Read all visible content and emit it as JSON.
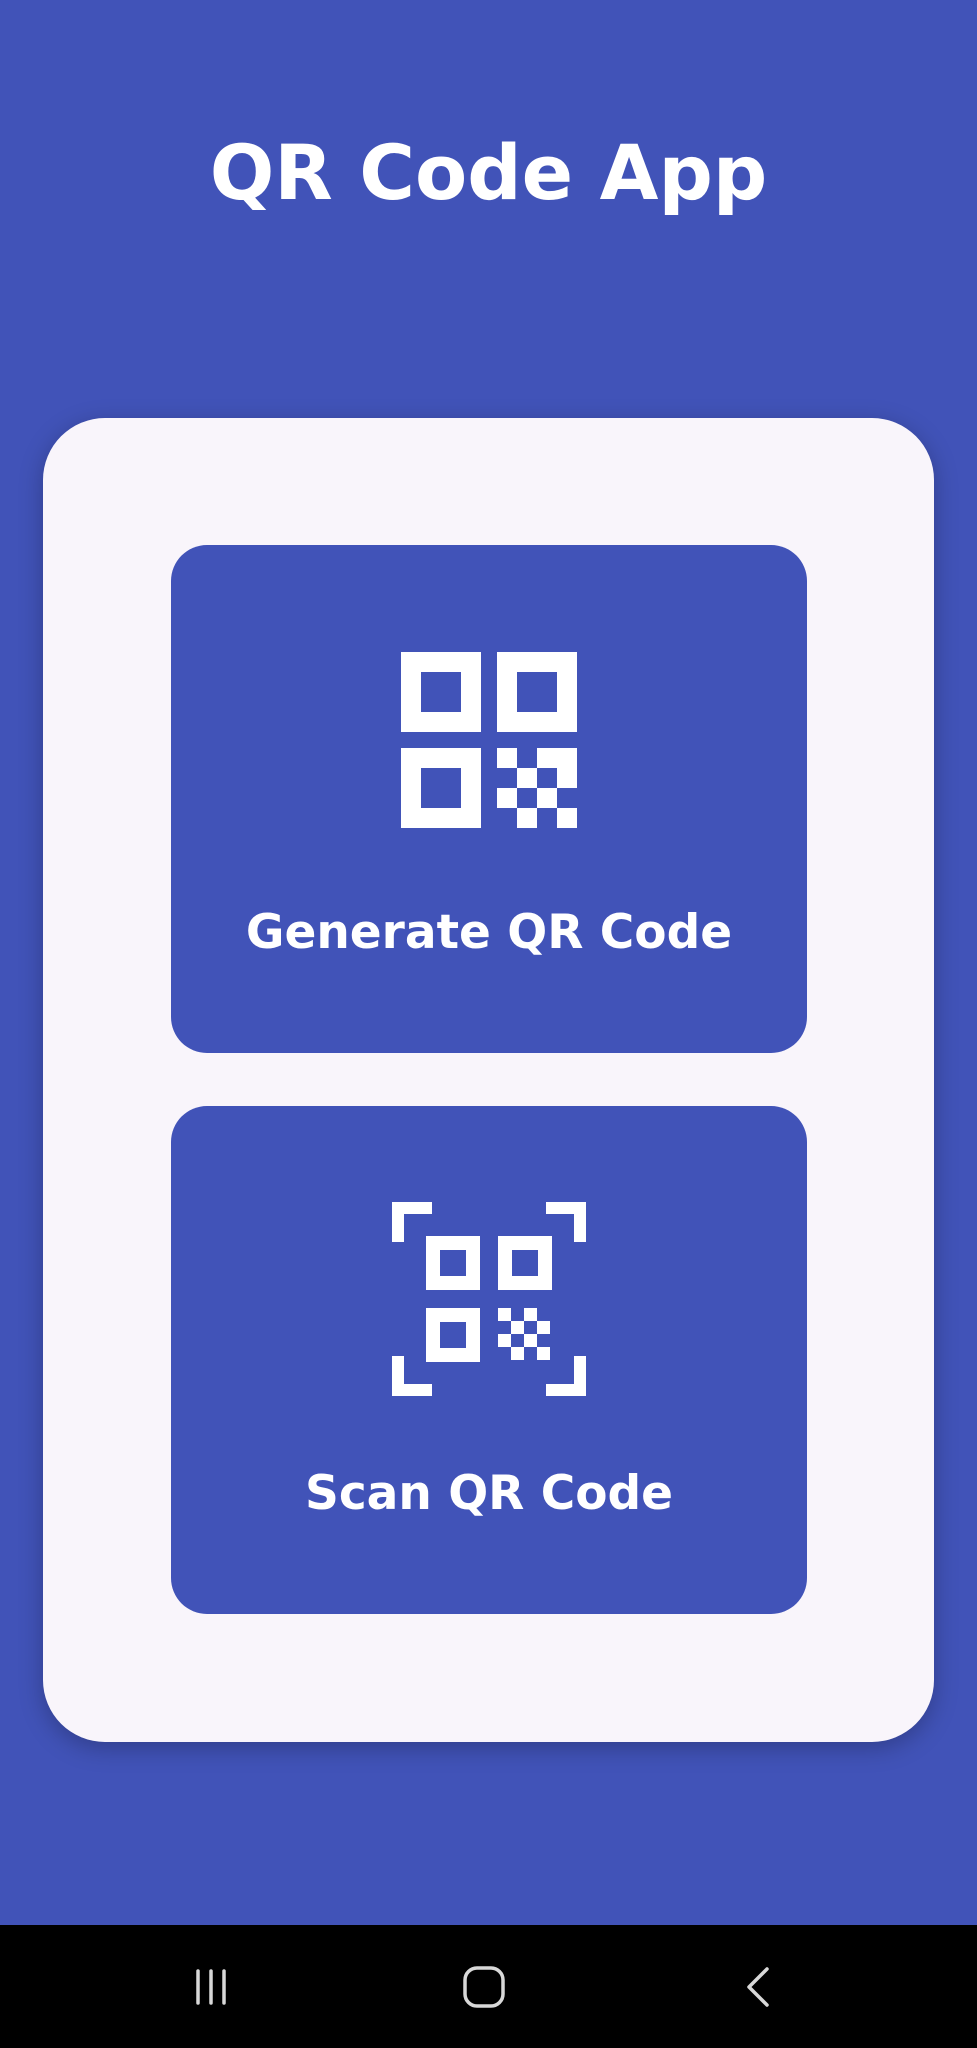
{
  "app": {
    "title": "QR Code App"
  },
  "actions": {
    "generate": {
      "label": "Generate QR Code",
      "icon": "qr-code-icon"
    },
    "scan": {
      "label": "Scan QR Code",
      "icon": "qr-scan-icon"
    }
  },
  "navigation": {
    "recents_icon": "recents-icon",
    "home_icon": "home-icon",
    "back_icon": "back-icon"
  },
  "colors": {
    "primary": "#4153b8",
    "panel": "#f9f5fb",
    "on_primary": "#ffffff",
    "nav_bar": "#000000"
  }
}
